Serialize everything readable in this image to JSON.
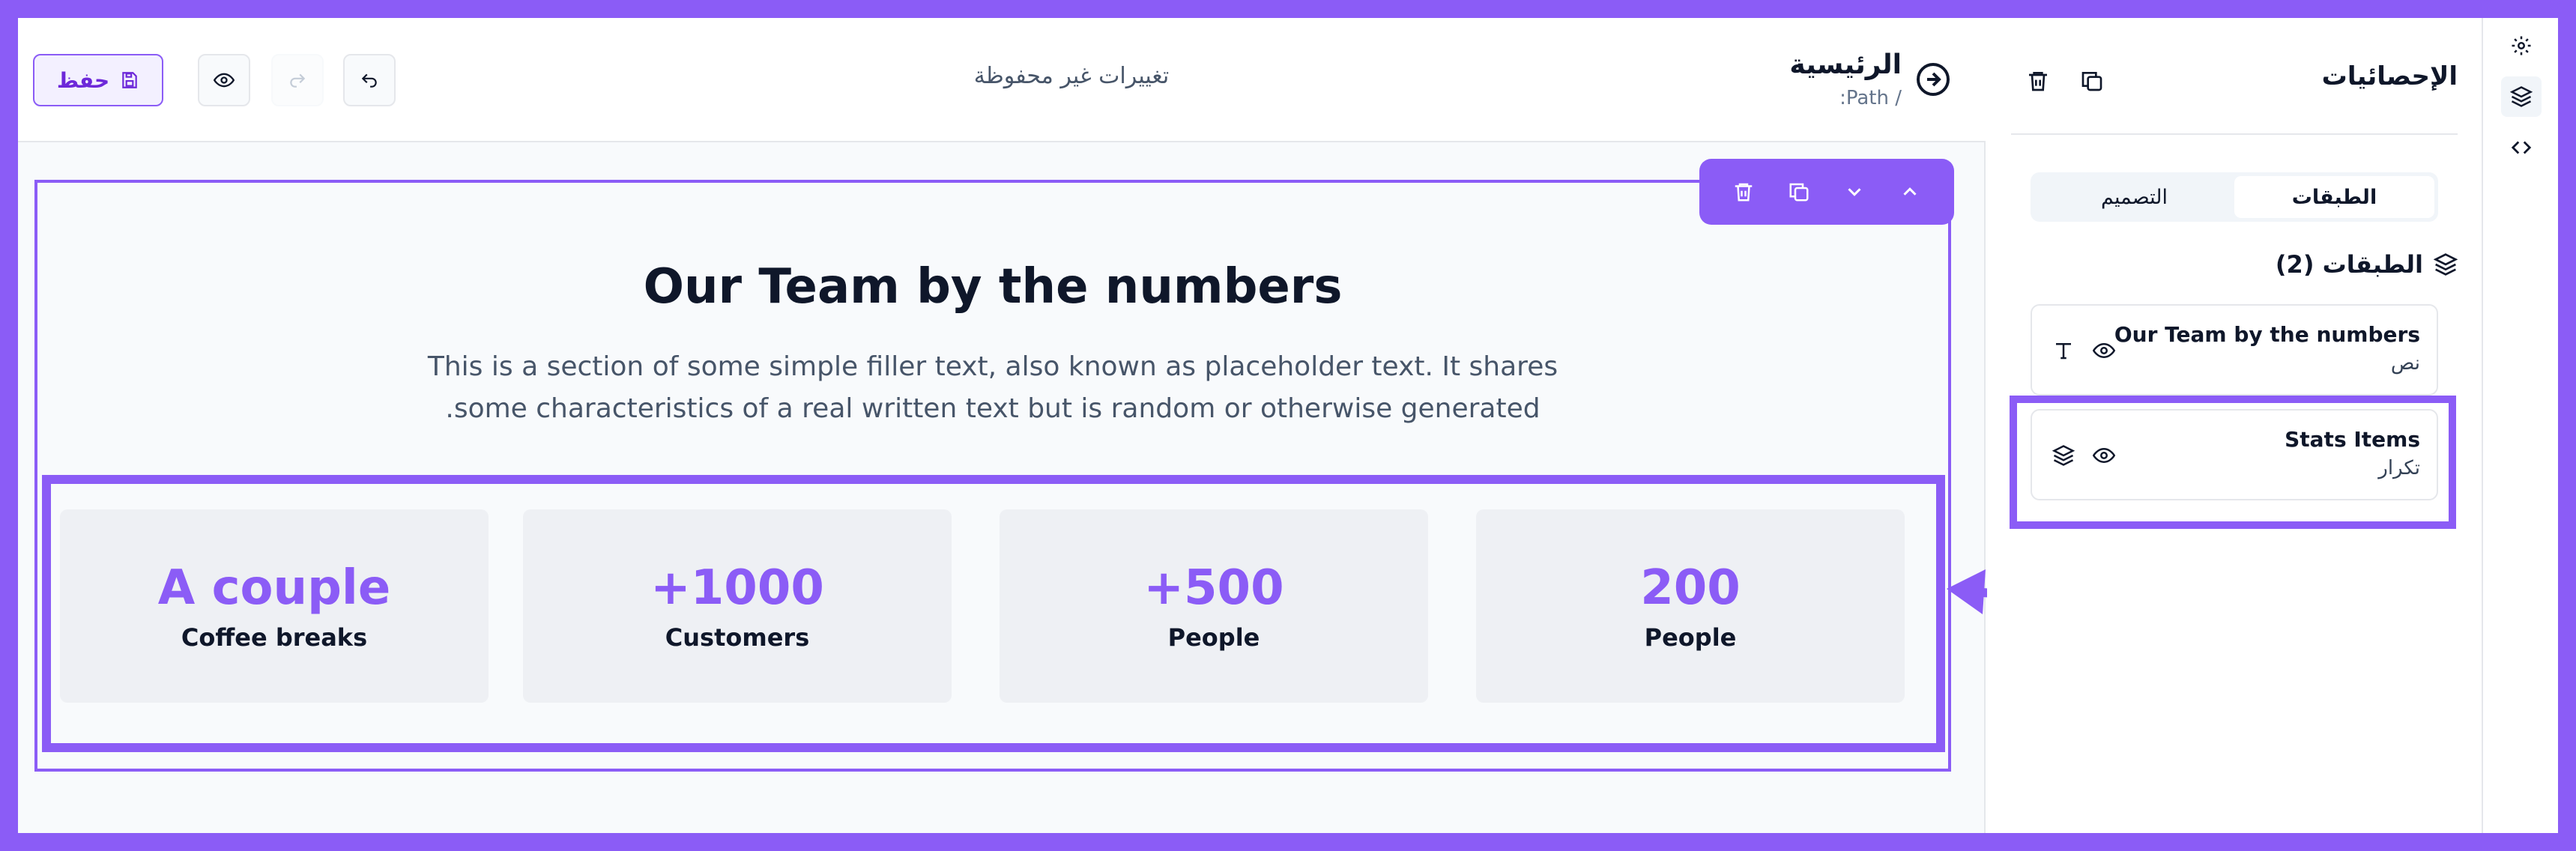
{
  "toolbar": {
    "save_label": "حفظ",
    "unsaved_text": "تغييرات غير محفوظة"
  },
  "page": {
    "title": "الرئيسية",
    "path": ":Path /"
  },
  "section": {
    "heading": "Our Team by the numbers",
    "description_line1": "This is a section of some simple filler text, also known as placeholder text. It shares",
    "description_line2": ".some characteristics of a real written text but is random or otherwise generated"
  },
  "stats": [
    {
      "value": "200",
      "label": "People"
    },
    {
      "value": "+500",
      "label": "People"
    },
    {
      "value": "+1000",
      "label": "Customers"
    },
    {
      "value": "A couple",
      "label": "Coffee breaks"
    }
  ],
  "panel": {
    "title": "الإحصائيات",
    "tabs": [
      {
        "label": "الطبقات",
        "active": true
      },
      {
        "label": "التصميم",
        "active": false
      }
    ],
    "layers_heading": "الطبقات (2)",
    "layers": [
      {
        "name": "Our Team by the numbers",
        "type": "نص",
        "icon": "text-icon"
      },
      {
        "name": "Stats Items",
        "type": "تكرار",
        "icon": "layers-icon"
      }
    ]
  },
  "colors": {
    "accent": "#8b5cf6",
    "text": "#0f172a",
    "muted": "#475569",
    "card": "#eef0f4"
  },
  "icons": [
    "save-icon",
    "eye-icon",
    "redo-icon",
    "undo-icon",
    "arrow-right-circle-icon",
    "trash-icon",
    "copy-icon",
    "chevron-down-icon",
    "chevron-up-icon",
    "layers-icon",
    "text-icon",
    "gear-icon",
    "code-icon"
  ]
}
